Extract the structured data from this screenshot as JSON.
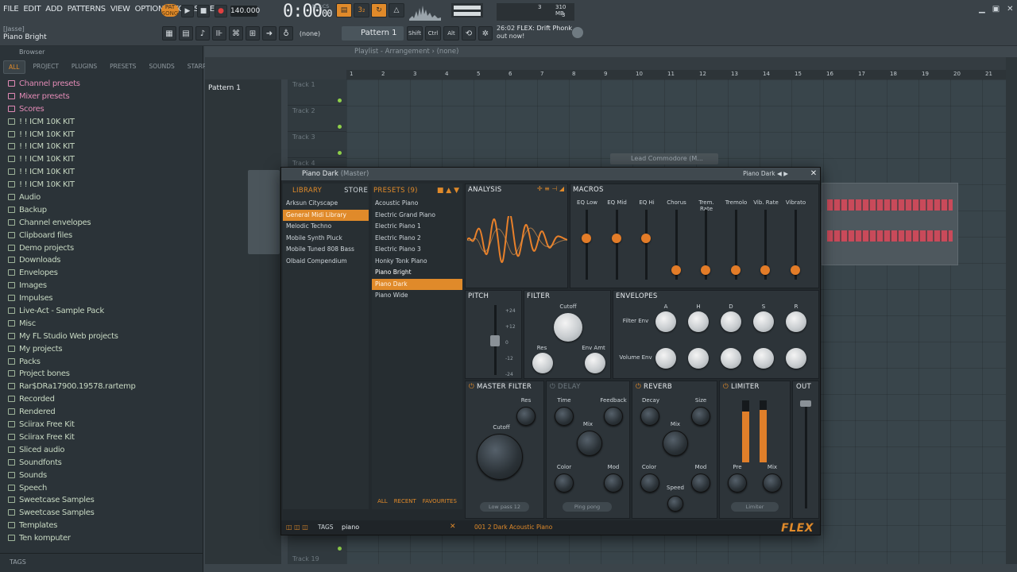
{
  "menu": [
    "FILE",
    "EDIT",
    "ADD",
    "PATTERNS",
    "VIEW",
    "OPTIONS",
    "TOOLS",
    "HELP"
  ],
  "hint": {
    "top": "[Jasse]",
    "bottom": "Piano Bright"
  },
  "transport": {
    "pat_label": "PAT",
    "song_label": "SONG",
    "bpm": "140.000",
    "time_main": "0:00",
    "time_small": "00",
    "time_unit": "M:S:CS"
  },
  "cpu": {
    "a": "3",
    "b": "310 MB",
    "c": "3"
  },
  "toolbar": {
    "snap": "(none)",
    "pattern": "Pattern 1",
    "shift": "Shift",
    "ctrl": "Ctrl",
    "alt": "Alt"
  },
  "news": {
    "time": "26:02",
    "title": "FLEX: Drift Phonk",
    "sub": "out now!"
  },
  "browser": {
    "title": "Browser",
    "tabs": [
      "ALL",
      "PROJECT",
      "PLUGINS",
      "PRESETS",
      "SOUNDS",
      "STARRED"
    ],
    "items": [
      {
        "label": "Channel presets",
        "pink": true
      },
      {
        "label": "Mixer presets",
        "pink": true
      },
      {
        "label": "Scores",
        "pink": true
      },
      {
        "label": "! ! ICM 10K KIT"
      },
      {
        "label": "! ! ICM 10K KIT"
      },
      {
        "label": "! ! ICM 10K KIT"
      },
      {
        "label": "! ! ICM 10K KIT"
      },
      {
        "label": "! ! ICM 10K KIT"
      },
      {
        "label": "! ! ICM 10K KIT"
      },
      {
        "label": "Audio"
      },
      {
        "label": "Backup"
      },
      {
        "label": "Channel envelopes"
      },
      {
        "label": "Clipboard files"
      },
      {
        "label": "Demo projects"
      },
      {
        "label": "Downloads"
      },
      {
        "label": "Envelopes"
      },
      {
        "label": "Images"
      },
      {
        "label": "Impulses"
      },
      {
        "label": "Live-Act - Sample Pack"
      },
      {
        "label": "Misc"
      },
      {
        "label": "My FL Studio Web projects"
      },
      {
        "label": "My projects"
      },
      {
        "label": "Packs"
      },
      {
        "label": "Project bones"
      },
      {
        "label": "Rar$DRa17900.19578.rartemp"
      },
      {
        "label": "Recorded"
      },
      {
        "label": "Rendered"
      },
      {
        "label": "Sciirax Free Kit"
      },
      {
        "label": "Sciirax Free Kit"
      },
      {
        "label": "Sliced audio"
      },
      {
        "label": "Soundfonts"
      },
      {
        "label": "Sounds"
      },
      {
        "label": "Speech"
      },
      {
        "label": "Sweetcase Samples"
      },
      {
        "label": "Sweetcase Samples"
      },
      {
        "label": "Templates"
      },
      {
        "label": "Ten komputer"
      }
    ],
    "tags": "TAGS"
  },
  "playlist": {
    "header": "Playlist - Arrangement",
    "header_sel": "(none)",
    "pattern_item": "Pattern 1",
    "ruler": [
      "1",
      "2",
      "3",
      "4",
      "5",
      "6",
      "7",
      "8",
      "9",
      "10",
      "11",
      "12",
      "13",
      "14",
      "15",
      "16",
      "17",
      "18",
      "19",
      "20",
      "21"
    ],
    "tracks": [
      "Track 1",
      "Track 2",
      "Track 3",
      "Track 4"
    ],
    "track_bottom": "Track 19"
  },
  "lead_window": "Lead Commodore (M...",
  "flex": {
    "title": "Piano Dark",
    "title_sub": "(Master)",
    "title_right": "Piano Dark",
    "library_tab": "LIBRARY",
    "store_tab": "STORE",
    "presets_tab": "PRESETS (9)",
    "library": [
      "Arksun Cityscape",
      "General Midi Library",
      "Melodic Techno",
      "Mobile Synth Pluck",
      "Mobile Tuned 808 Bass",
      "Olbaid Compendium"
    ],
    "library_selected": 1,
    "presets": [
      "Acoustic Piano",
      "Electric Grand Piano",
      "Electric Piano 1",
      "Electric Piano 2",
      "Electric Piano 3",
      "Honky Tonk Piano",
      "Piano Bright",
      "Piano Dark",
      "Piano Wide"
    ],
    "preset_hover": 6,
    "preset_selected": 7,
    "filter_tabs": [
      "ALL",
      "RECENT",
      "FAVOURITES"
    ],
    "tags_label": "TAGS",
    "search": "piano",
    "analysis": "ANALYSIS",
    "macros": {
      "title": "MACROS",
      "labels": [
        "EQ Low",
        "EQ Mid",
        "EQ Hi",
        "Chorus",
        "Trem. Rate",
        "Tremolo",
        "Vib. Rate",
        "Vibrato"
      ]
    },
    "pitch": {
      "title": "PITCH",
      "ticks": [
        "+24",
        "+12",
        "0",
        "-12",
        "-24"
      ]
    },
    "filter": {
      "title": "FILTER",
      "cutoff": "Cutoff",
      "res": "Res",
      "env_amt": "Env Amt"
    },
    "envelopes": {
      "title": "ENVELOPES",
      "cols": [
        "A",
        "H",
        "D",
        "S",
        "R"
      ],
      "rows": [
        "Filter Env",
        "Volume Env"
      ]
    },
    "master_filter": {
      "title": "MASTER FILTER",
      "res": "Res",
      "cutoff": "Cutoff",
      "mode": "Low pass 12"
    },
    "delay": {
      "title": "DELAY",
      "time": "Time",
      "feedback": "Feedback",
      "mix": "Mix",
      "color": "Color",
      "mod": "Mod",
      "mode": "Ping pong"
    },
    "reverb": {
      "title": "REVERB",
      "decay": "Decay",
      "size": "Size",
      "mix": "Mix",
      "color": "Color",
      "mod": "Mod",
      "speed": "Speed"
    },
    "limiter": {
      "title": "LIMITER",
      "pre": "Pre",
      "mix": "Mix",
      "mode": "Limiter"
    },
    "out": "OUT",
    "footer_preset": "001 2 Dark Acoustic Piano",
    "logo": "FLEX"
  },
  "colors": {
    "accent": "#e08a2a",
    "folder": "#c7d8c2",
    "pink": "#e18ab5"
  }
}
